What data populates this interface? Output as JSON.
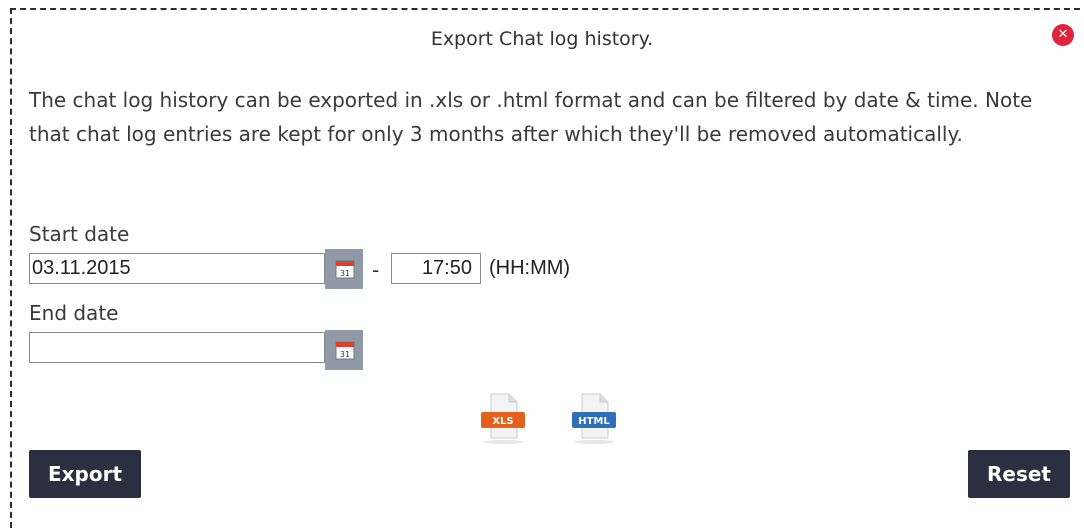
{
  "dialog": {
    "title": "Export Chat log history.",
    "close_icon": "close-icon",
    "description": "The chat log history can be exported in .xls or .html format and can be filtered by date & time. Note that chat log entries are kept for only 3 months after which they'll be removed automatically."
  },
  "start": {
    "label": "Start date",
    "date_value": "03.11.2015",
    "separator": "-",
    "time_value": "17:50",
    "time_format": "(HH:MM)",
    "calendar_icon": "calendar-icon",
    "calendar_day": "31"
  },
  "end": {
    "label": "End date",
    "date_value": "",
    "calendar_icon": "calendar-icon",
    "calendar_day": "31"
  },
  "formats": [
    {
      "icon": "xls-file-icon",
      "label": "XLS",
      "color": "#e2601d"
    },
    {
      "icon": "html-file-icon",
      "label": "HTML",
      "color": "#2e6fb8"
    }
  ],
  "actions": {
    "export_label": "Export",
    "reset_label": "Reset"
  },
  "colors": {
    "button_bg": "#2b2f40",
    "close_bg": "#e0233f",
    "calendar_bg": "#8f9aa6"
  }
}
